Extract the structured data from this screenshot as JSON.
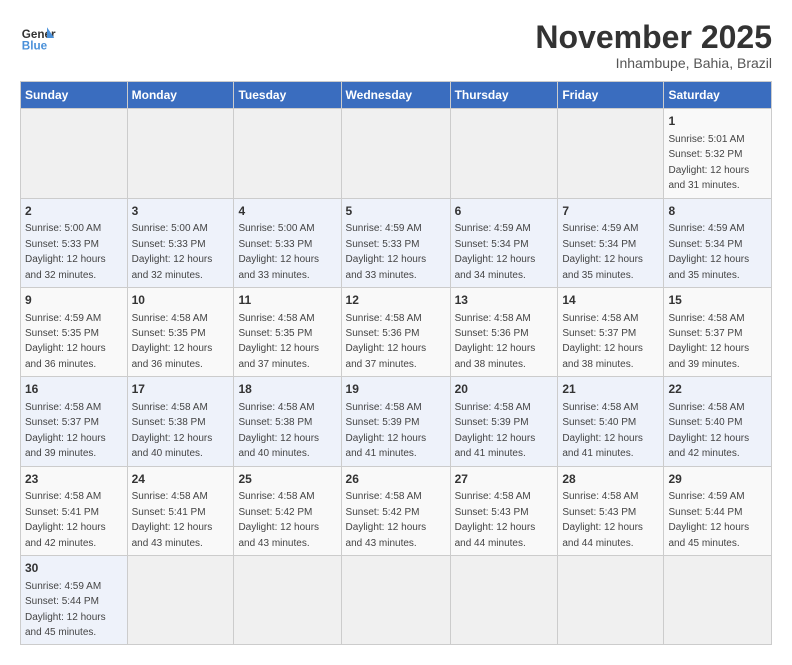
{
  "header": {
    "logo_general": "General",
    "logo_blue": "Blue",
    "month": "November 2025",
    "location": "Inhambupe, Bahia, Brazil"
  },
  "days_of_week": [
    "Sunday",
    "Monday",
    "Tuesday",
    "Wednesday",
    "Thursday",
    "Friday",
    "Saturday"
  ],
  "weeks": [
    [
      {
        "day": "",
        "info": ""
      },
      {
        "day": "",
        "info": ""
      },
      {
        "day": "",
        "info": ""
      },
      {
        "day": "",
        "info": ""
      },
      {
        "day": "",
        "info": ""
      },
      {
        "day": "",
        "info": ""
      },
      {
        "day": "1",
        "info": "Sunrise: 5:01 AM\nSunset: 5:32 PM\nDaylight: 12 hours and 31 minutes."
      }
    ],
    [
      {
        "day": "2",
        "info": "Sunrise: 5:00 AM\nSunset: 5:33 PM\nDaylight: 12 hours and 32 minutes."
      },
      {
        "day": "3",
        "info": "Sunrise: 5:00 AM\nSunset: 5:33 PM\nDaylight: 12 hours and 32 minutes."
      },
      {
        "day": "4",
        "info": "Sunrise: 5:00 AM\nSunset: 5:33 PM\nDaylight: 12 hours and 33 minutes."
      },
      {
        "day": "5",
        "info": "Sunrise: 4:59 AM\nSunset: 5:33 PM\nDaylight: 12 hours and 33 minutes."
      },
      {
        "day": "6",
        "info": "Sunrise: 4:59 AM\nSunset: 5:34 PM\nDaylight: 12 hours and 34 minutes."
      },
      {
        "day": "7",
        "info": "Sunrise: 4:59 AM\nSunset: 5:34 PM\nDaylight: 12 hours and 35 minutes."
      },
      {
        "day": "8",
        "info": "Sunrise: 4:59 AM\nSunset: 5:34 PM\nDaylight: 12 hours and 35 minutes."
      }
    ],
    [
      {
        "day": "9",
        "info": "Sunrise: 4:59 AM\nSunset: 5:35 PM\nDaylight: 12 hours and 36 minutes."
      },
      {
        "day": "10",
        "info": "Sunrise: 4:58 AM\nSunset: 5:35 PM\nDaylight: 12 hours and 36 minutes."
      },
      {
        "day": "11",
        "info": "Sunrise: 4:58 AM\nSunset: 5:35 PM\nDaylight: 12 hours and 37 minutes."
      },
      {
        "day": "12",
        "info": "Sunrise: 4:58 AM\nSunset: 5:36 PM\nDaylight: 12 hours and 37 minutes."
      },
      {
        "day": "13",
        "info": "Sunrise: 4:58 AM\nSunset: 5:36 PM\nDaylight: 12 hours and 38 minutes."
      },
      {
        "day": "14",
        "info": "Sunrise: 4:58 AM\nSunset: 5:37 PM\nDaylight: 12 hours and 38 minutes."
      },
      {
        "day": "15",
        "info": "Sunrise: 4:58 AM\nSunset: 5:37 PM\nDaylight: 12 hours and 39 minutes."
      }
    ],
    [
      {
        "day": "16",
        "info": "Sunrise: 4:58 AM\nSunset: 5:37 PM\nDaylight: 12 hours and 39 minutes."
      },
      {
        "day": "17",
        "info": "Sunrise: 4:58 AM\nSunset: 5:38 PM\nDaylight: 12 hours and 40 minutes."
      },
      {
        "day": "18",
        "info": "Sunrise: 4:58 AM\nSunset: 5:38 PM\nDaylight: 12 hours and 40 minutes."
      },
      {
        "day": "19",
        "info": "Sunrise: 4:58 AM\nSunset: 5:39 PM\nDaylight: 12 hours and 41 minutes."
      },
      {
        "day": "20",
        "info": "Sunrise: 4:58 AM\nSunset: 5:39 PM\nDaylight: 12 hours and 41 minutes."
      },
      {
        "day": "21",
        "info": "Sunrise: 4:58 AM\nSunset: 5:40 PM\nDaylight: 12 hours and 41 minutes."
      },
      {
        "day": "22",
        "info": "Sunrise: 4:58 AM\nSunset: 5:40 PM\nDaylight: 12 hours and 42 minutes."
      }
    ],
    [
      {
        "day": "23",
        "info": "Sunrise: 4:58 AM\nSunset: 5:41 PM\nDaylight: 12 hours and 42 minutes."
      },
      {
        "day": "24",
        "info": "Sunrise: 4:58 AM\nSunset: 5:41 PM\nDaylight: 12 hours and 43 minutes."
      },
      {
        "day": "25",
        "info": "Sunrise: 4:58 AM\nSunset: 5:42 PM\nDaylight: 12 hours and 43 minutes."
      },
      {
        "day": "26",
        "info": "Sunrise: 4:58 AM\nSunset: 5:42 PM\nDaylight: 12 hours and 43 minutes."
      },
      {
        "day": "27",
        "info": "Sunrise: 4:58 AM\nSunset: 5:43 PM\nDaylight: 12 hours and 44 minutes."
      },
      {
        "day": "28",
        "info": "Sunrise: 4:58 AM\nSunset: 5:43 PM\nDaylight: 12 hours and 44 minutes."
      },
      {
        "day": "29",
        "info": "Sunrise: 4:59 AM\nSunset: 5:44 PM\nDaylight: 12 hours and 45 minutes."
      }
    ],
    [
      {
        "day": "30",
        "info": "Sunrise: 4:59 AM\nSunset: 5:44 PM\nDaylight: 12 hours and 45 minutes."
      },
      {
        "day": "",
        "info": ""
      },
      {
        "day": "",
        "info": ""
      },
      {
        "day": "",
        "info": ""
      },
      {
        "day": "",
        "info": ""
      },
      {
        "day": "",
        "info": ""
      },
      {
        "day": "",
        "info": ""
      }
    ]
  ]
}
